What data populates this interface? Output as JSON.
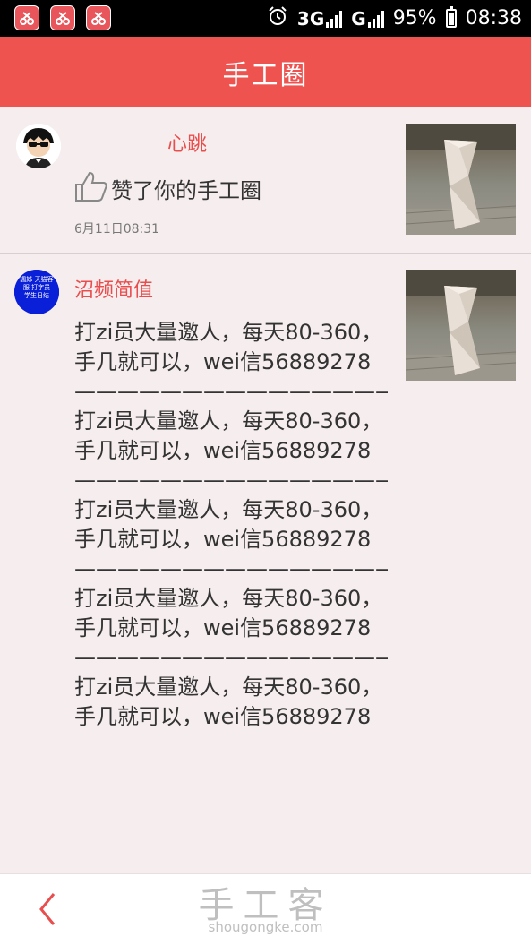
{
  "status_bar": {
    "network1": "3G",
    "network2": "G",
    "battery": "95%",
    "time": "08:38"
  },
  "header": {
    "title": "手工圈"
  },
  "notifications": [
    {
      "username": "心跳",
      "action_text": "赞了你的手工圈",
      "timestamp": "6月11日08:31"
    },
    {
      "username": "沼频简值",
      "avatar_text": "諷姊 天猫客服 打字员 学生日结",
      "message": "打zi员大量邀人，每天80-360，手几就可以，wei信56889278——————————————————————打zi员大量邀人，每天80-360，手几就可以，wei信56889278——————————————————打zi员大量邀人，每天80-360，手几就可以，wei信56889278——————————————————打zi员大量邀人，每天80-360，手几就可以，wei信56889278——————————————————打zi员大量邀人，每天80-360，手几就可以，wei信56889278"
    }
  ],
  "bottom": {
    "watermark_main": "手工客",
    "watermark_url": "shougongke.com"
  },
  "colors": {
    "accent": "#ef5350",
    "username": "#e94e4e"
  },
  "icons": [
    "back-arrow-icon",
    "thumbs-up-icon",
    "alarm-icon",
    "battery-icon"
  ]
}
